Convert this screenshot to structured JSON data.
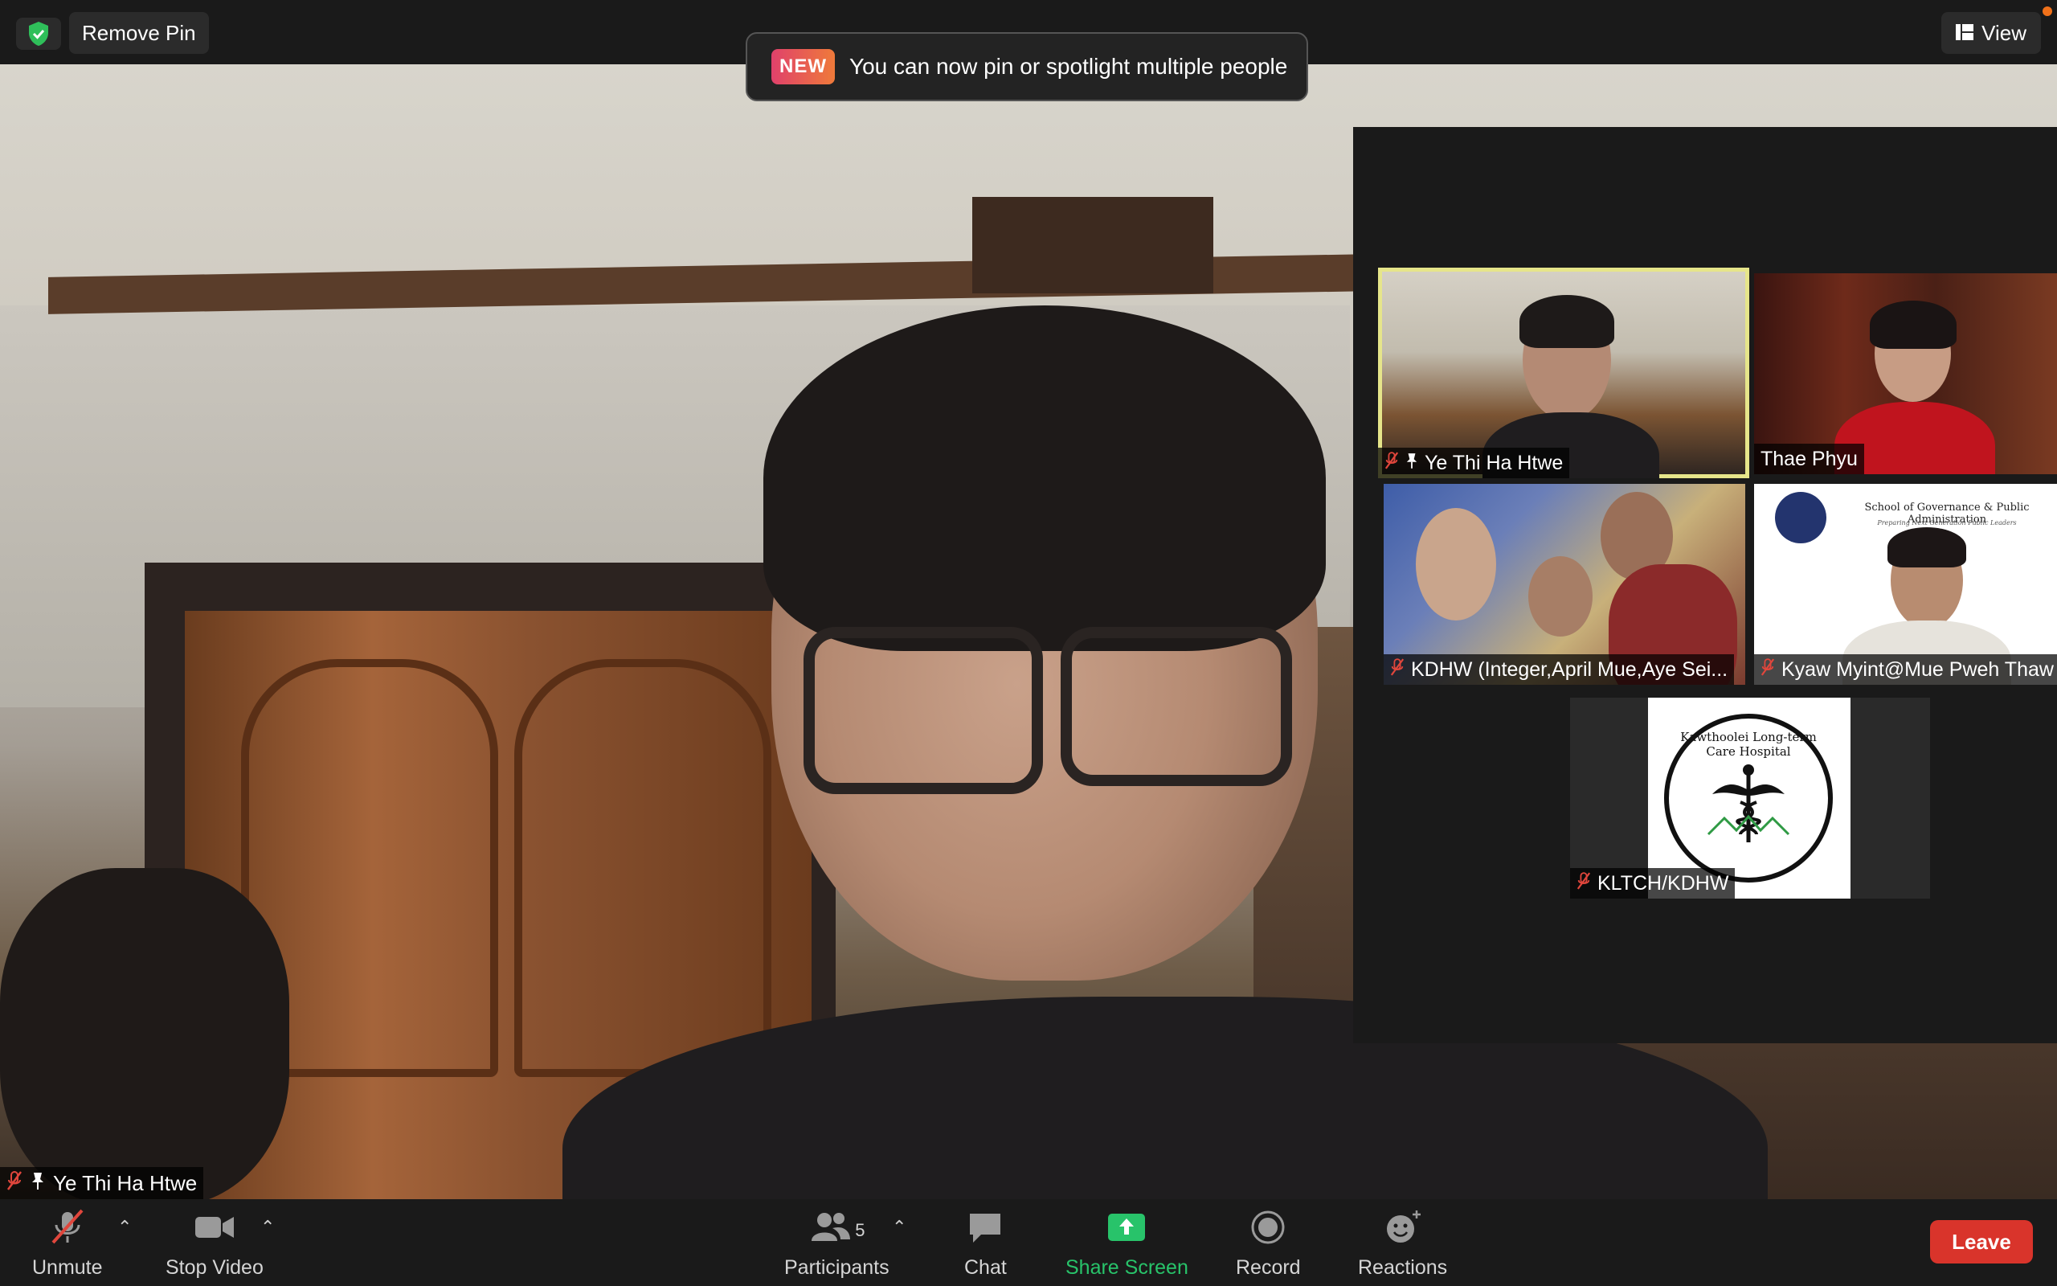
{
  "top": {
    "remove_pin_label": "Remove Pin",
    "view_label": "View",
    "toast_badge": "NEW",
    "toast_text": "You can now pin or spotlight multiple people"
  },
  "main_video": {
    "participant_name": "Ye Thi Ha Htwe"
  },
  "gallery": {
    "tiles": [
      {
        "name": "Ye Thi Ha Htwe",
        "muted": true,
        "pinned": true,
        "active_speaker": true
      },
      {
        "name": "Thae Phyu",
        "muted": false,
        "pinned": false
      },
      {
        "name": "KDHW (Integer,April Mue,Aye Sei...",
        "muted": true,
        "pinned": false
      },
      {
        "name": "Kyaw Myint@Mue Pweh Thaw",
        "muted": true,
        "pinned": false
      },
      {
        "name": "KLTCH/KDHW",
        "muted": true,
        "pinned": false
      }
    ],
    "tile4_header": "School of Governance & Public Administration",
    "tile4_subheader": "Preparing Next Generation Public Leaders",
    "tile5_logo_text": "Kawthoolei Long-term Care Hospital"
  },
  "toolbar": {
    "unmute_label": "Unmute",
    "stop_video_label": "Stop Video",
    "participants_label": "Participants",
    "participants_count": "5",
    "chat_label": "Chat",
    "share_screen_label": "Share Screen",
    "record_label": "Record",
    "reactions_label": "Reactions",
    "leave_label": "Leave"
  },
  "colors": {
    "active_speaker_border": "#e6e58a",
    "share_green": "#28c36a",
    "leave_red": "#d9342b",
    "muted_red": "#e0463c"
  }
}
